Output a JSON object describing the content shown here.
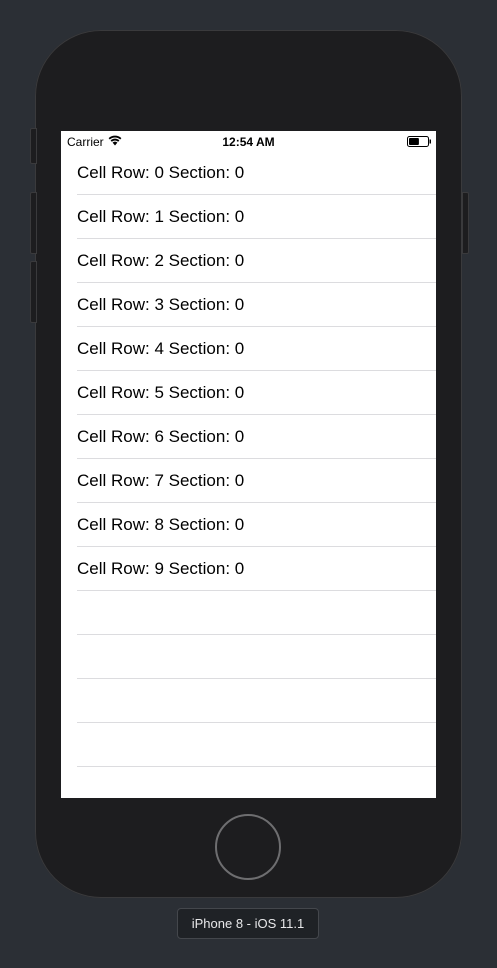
{
  "status_bar": {
    "carrier": "Carrier",
    "time": "12:54 AM",
    "wifi_icon": "wifi-icon",
    "battery_icon": "battery-icon",
    "battery_level": 0.55
  },
  "table": {
    "rows": [
      {
        "label": "Cell Row: 0 Section: 0"
      },
      {
        "label": "Cell Row: 1 Section: 0"
      },
      {
        "label": "Cell Row: 2 Section: 0"
      },
      {
        "label": "Cell Row: 3 Section: 0"
      },
      {
        "label": "Cell Row: 4 Section: 0"
      },
      {
        "label": "Cell Row: 5 Section: 0"
      },
      {
        "label": "Cell Row: 6 Section: 0"
      },
      {
        "label": "Cell Row: 7 Section: 0"
      },
      {
        "label": "Cell Row: 8 Section: 0"
      },
      {
        "label": "Cell Row: 9 Section: 0"
      },
      {
        "label": ""
      },
      {
        "label": ""
      },
      {
        "label": ""
      },
      {
        "label": ""
      }
    ]
  },
  "device": {
    "label": "iPhone 8 - iOS 11.1"
  },
  "colors": {
    "backdrop": "#2b2f35",
    "bezel": "#1d1d1f",
    "separator": "#dcdcdf"
  }
}
